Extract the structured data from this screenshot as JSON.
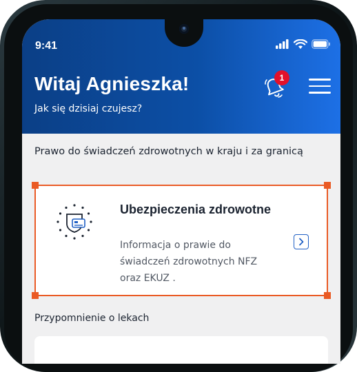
{
  "status_bar": {
    "time": "9:41"
  },
  "header": {
    "greeting": "Witaj Agnieszka!",
    "subtitle": "Jak się dzisiaj czujesz?",
    "notification_count": "1"
  },
  "sections": {
    "benefits_title": "Prawo do świadczeń zdrowotnych w kraju i za granicą",
    "reminder_title": "Przypomnienie o lekach"
  },
  "card": {
    "title": "Ubezpieczenia zdrowotne",
    "description": "Informacja o prawie do świadczeń zdrowotnych NFZ oraz EKUZ ."
  },
  "colors": {
    "header_start": "#0b3f86",
    "header_end": "#1d70e6",
    "accent": "#ea5a24",
    "link_blue": "#1f5fc4",
    "badge": "#e3102a"
  },
  "icons": [
    "bell-icon",
    "menu-icon",
    "insurance-card-icon",
    "chevron-right-icon",
    "signal-icon",
    "wifi-icon",
    "battery-icon"
  ]
}
